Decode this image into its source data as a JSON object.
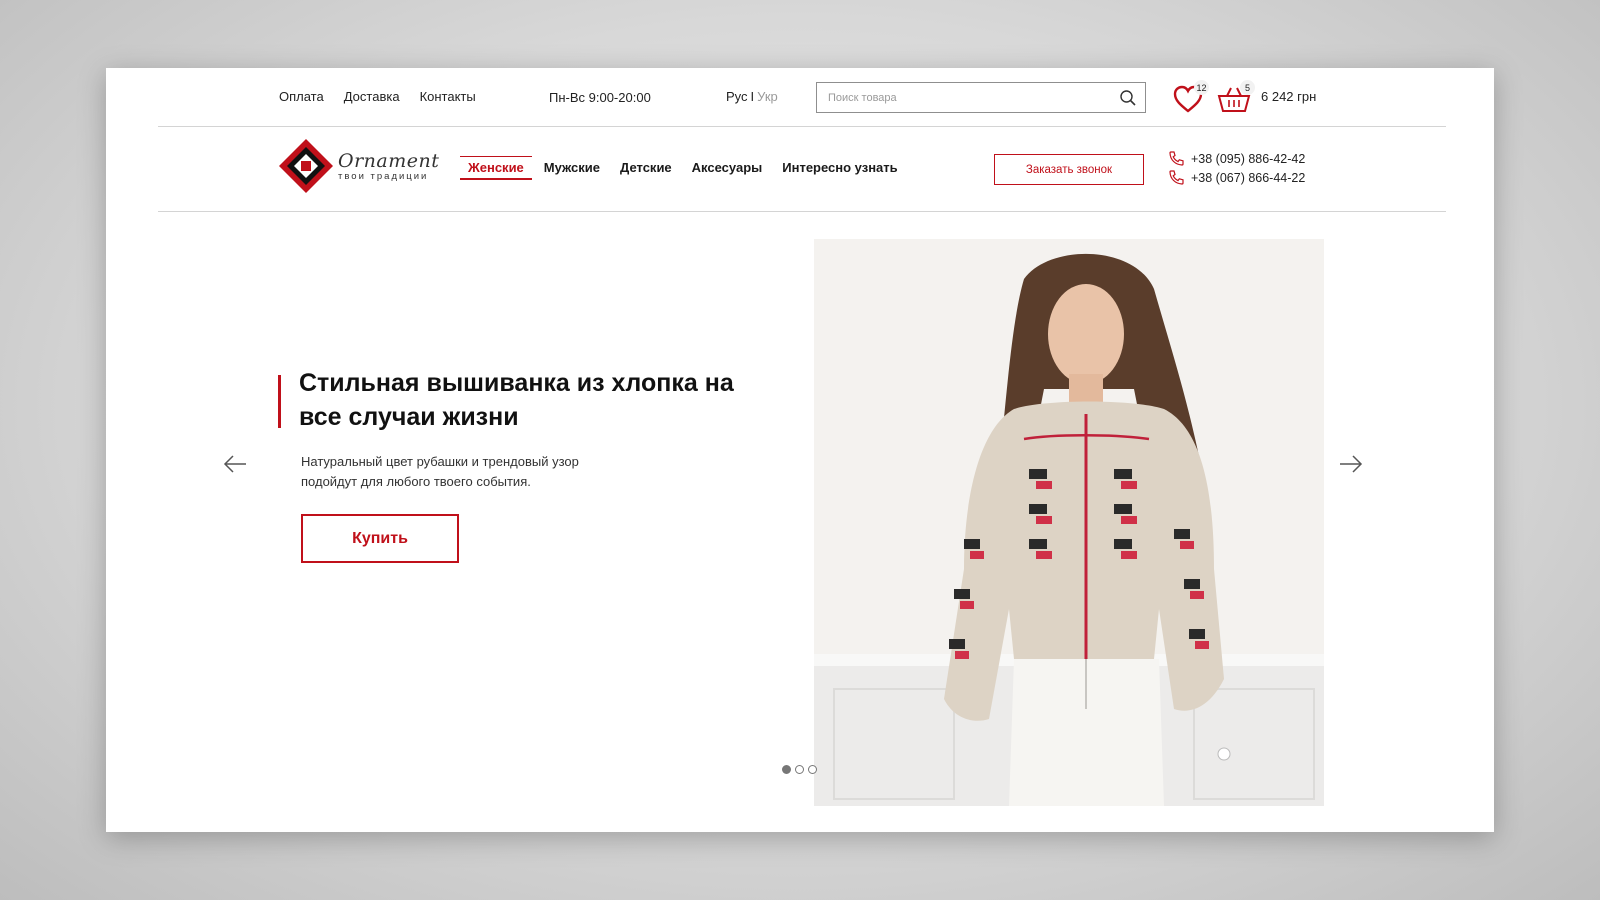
{
  "colors": {
    "accent": "#c0101a",
    "text": "#1a1a1a",
    "muted": "#9a9a9a"
  },
  "topbar": {
    "links": [
      "Оплата",
      "Доставка",
      "Контакты"
    ],
    "hours": "Пн-Вс 9:00-20:00",
    "lang_active": "Рус",
    "lang_separator": "I",
    "lang_inactive": "Укр",
    "search_placeholder": "Поиск товара",
    "favorites_count": "12",
    "cart_count": "5",
    "cart_total": "6 242 грн"
  },
  "header": {
    "logo_name": "Ornament",
    "logo_tagline": "твои традиции",
    "nav": [
      "Женские",
      "Мужские",
      "Детские",
      "Аксесуары",
      "Интересно узнать"
    ],
    "nav_active_index": 0,
    "callback_label": "Заказать звонок",
    "phones": [
      "+38 (095) 886-42-42",
      "+38 (067) 866-44-22"
    ]
  },
  "hero": {
    "title": "Стильная вышиванка из хлопка на все случаи жизни",
    "text": "Натуральный цвет рубашки и трендовый узор подойдут для любого твоего события.",
    "button_label": "Купить",
    "slide_count": 3,
    "active_slide": 0
  },
  "icons": [
    "search-icon",
    "heart-icon",
    "basket-icon",
    "phone-icon",
    "arrow-left-icon",
    "arrow-right-icon"
  ]
}
